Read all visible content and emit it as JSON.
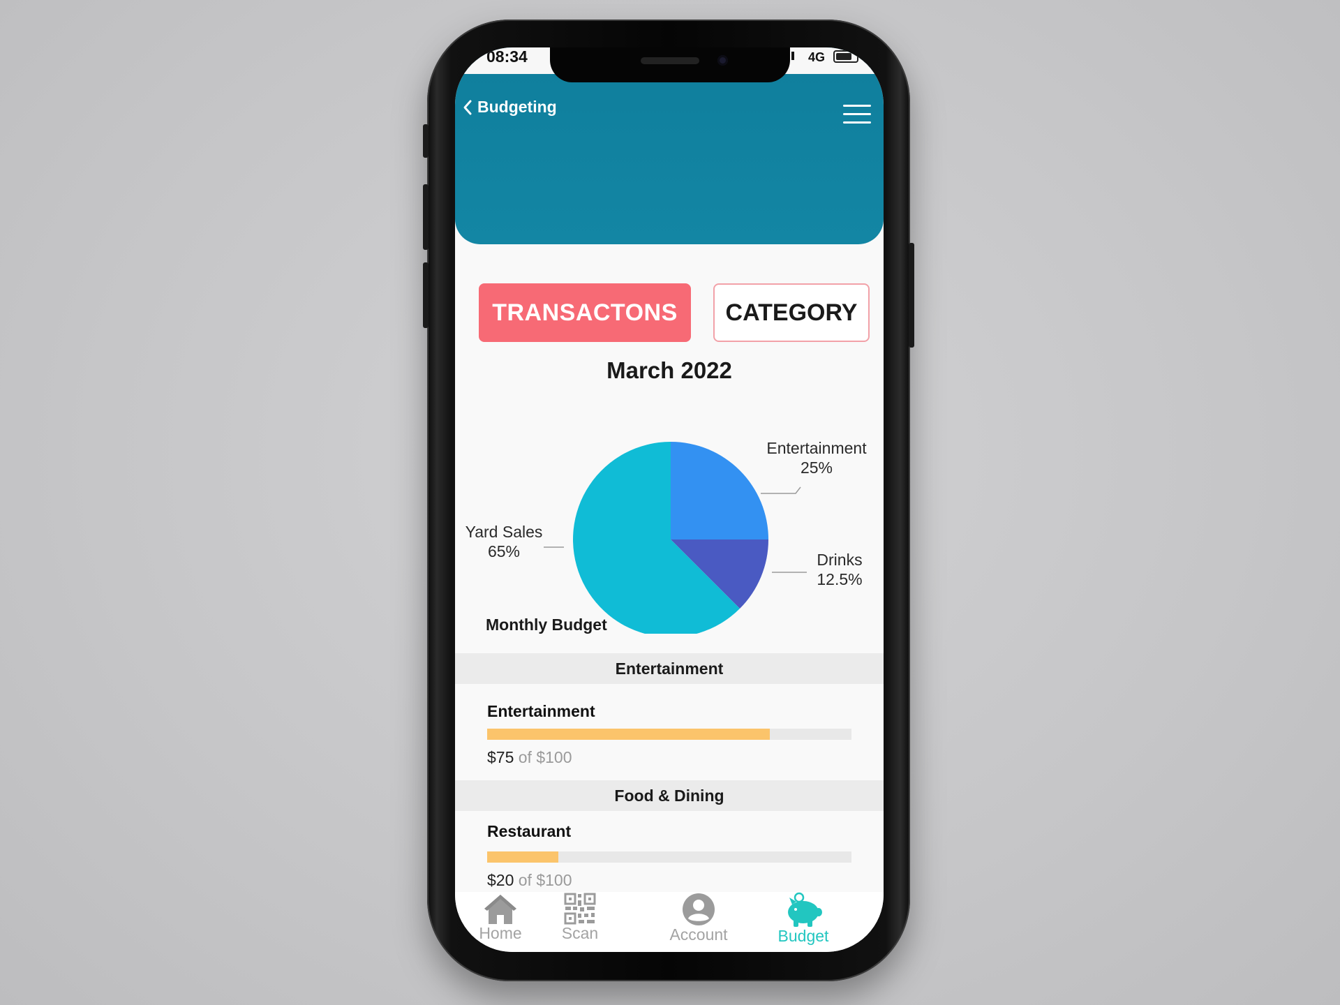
{
  "status_bar": {
    "time": "08:34",
    "network": "4G"
  },
  "header": {
    "back_label": "Budgeting",
    "accent_color": "#1386a4"
  },
  "tabs": [
    {
      "label": "TRANSACTONS",
      "active": true,
      "color": "#f76a75"
    },
    {
      "label": "CATEGORY",
      "active": false
    }
  ],
  "chart_data": {
    "type": "pie",
    "title": "March 2022",
    "slices": [
      {
        "label": "Entertainment",
        "percent_label": "25%",
        "value": 25,
        "color": "#3391f2"
      },
      {
        "label": "Drinks",
        "percent_label": "12.5%",
        "value": 12.5,
        "color": "#4a5ac2"
      },
      {
        "label": "Yard Sales",
        "percent_label": "65%",
        "value": 62.5,
        "color": "#10bcd6"
      }
    ]
  },
  "budget": {
    "section_title": "Monthly Budget",
    "groups": [
      {
        "header": "Entertainment",
        "items": [
          {
            "name": "Entertainment",
            "spent": "$75",
            "of_text": "of $100",
            "progress": 0.775
          }
        ]
      },
      {
        "header": "Food & Dining",
        "items": [
          {
            "name": "Restaurant",
            "spent": "$20",
            "of_text": "of $100",
            "progress": 0.195
          }
        ]
      }
    ]
  },
  "tabbar": {
    "items": [
      {
        "label": "Home",
        "icon": "home-icon",
        "active": false
      },
      {
        "label": "Scan",
        "icon": "qr-code-icon",
        "active": false
      },
      {
        "label": "Account",
        "icon": "account-icon",
        "active": false
      },
      {
        "label": "Budget",
        "icon": "piggy-bank-icon",
        "active": true
      }
    ],
    "active_color": "#22c6c0",
    "inactive_color": "#a3a3a3"
  }
}
